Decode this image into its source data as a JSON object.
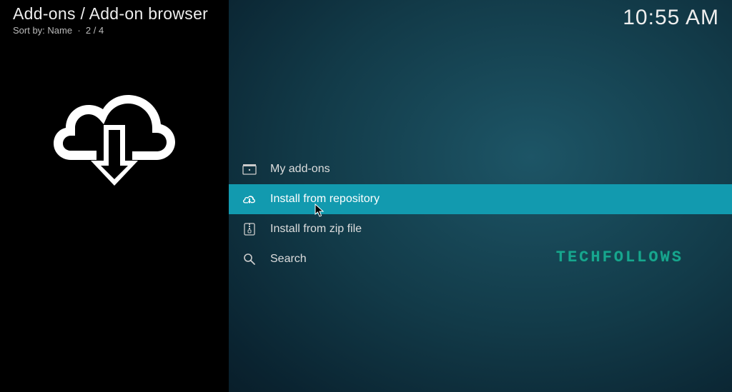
{
  "header": {
    "breadcrumb": "Add-ons / Add-on browser",
    "sort_prefix": "Sort by:",
    "sort_value": "Name",
    "page_indicator": "2 / 4",
    "clock": "10:55 AM"
  },
  "menu": {
    "items": [
      {
        "label": "My add-ons",
        "icon": "box-icon",
        "selected": false
      },
      {
        "label": "Install from repository",
        "icon": "download-cloud-icon",
        "selected": true
      },
      {
        "label": "Install from zip file",
        "icon": "zip-icon",
        "selected": false
      },
      {
        "label": "Search",
        "icon": "search-icon",
        "selected": false
      }
    ]
  },
  "watermark": "TECHFOLLOWS"
}
